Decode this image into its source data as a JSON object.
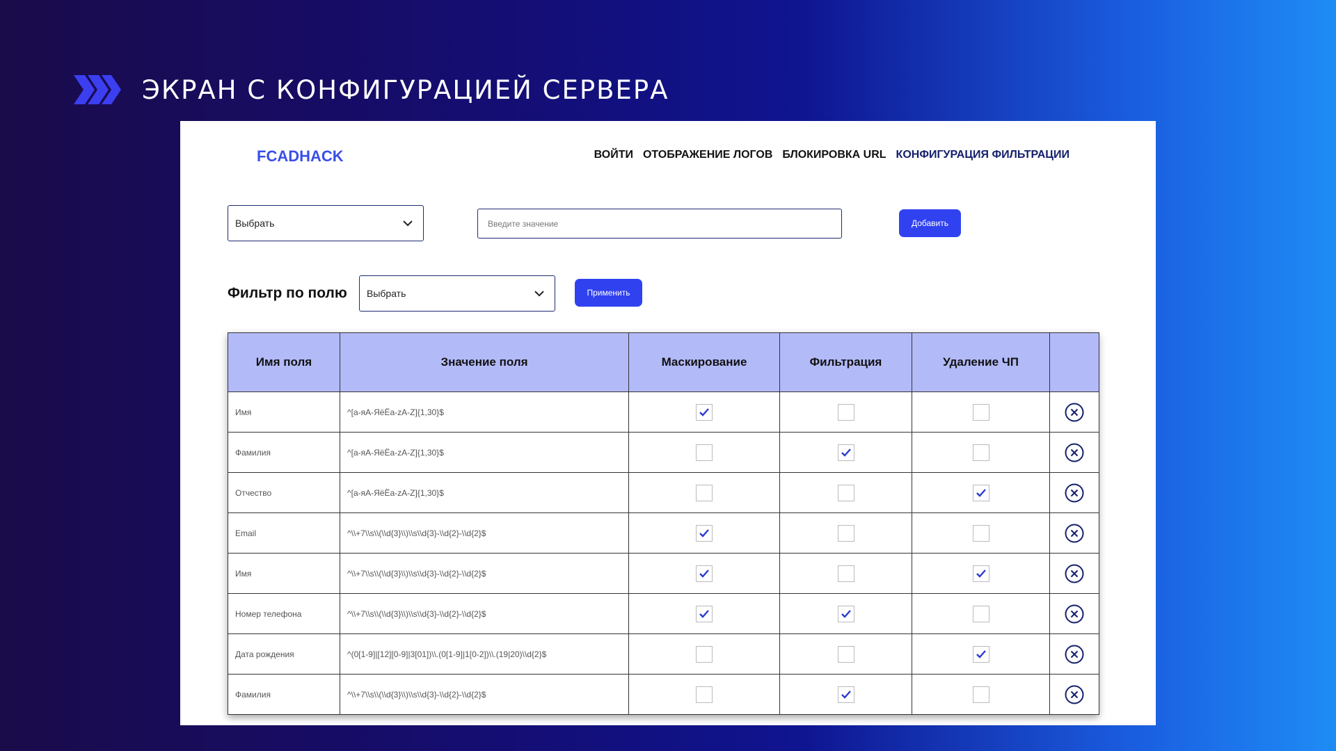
{
  "slide": {
    "title": "ЭКРАН С КОНФИГУРАЦИЕЙ СЕРВЕРА"
  },
  "app": {
    "logo": "FCADHACK",
    "nav": [
      {
        "label": "ВОЙТИ"
      },
      {
        "label": "ОТОБРАЖЕНИЕ ЛОГОВ"
      },
      {
        "label": "БЛОКИРОВКА URL"
      },
      {
        "label": "КОНФИГУРАЦИЯ ФИЛЬТРАЦИИ"
      }
    ],
    "add_row": {
      "select_value": "Выбрать",
      "input_placeholder": "Введите значение",
      "input_value": "",
      "add_button": "Добавить"
    },
    "filter_row": {
      "label": "Фильтр по полю",
      "select_value": "Выбрать",
      "apply_button": "Применить"
    },
    "table": {
      "headers": [
        "Имя поля",
        "Значение поля",
        "Маскирование",
        "Фильтрация",
        "Удаление ЧП",
        ""
      ],
      "rows": [
        {
          "name": "Имя",
          "value": "^[а-яА-ЯёЁa-zA-Z]{1,30}$",
          "masking": true,
          "filtering": false,
          "deletion": false
        },
        {
          "name": "Фамилия",
          "value": "^[а-яА-ЯёЁa-zA-Z]{1,30}$",
          "masking": false,
          "filtering": true,
          "deletion": false
        },
        {
          "name": "Отчество",
          "value": "^[а-яА-ЯёЁa-zA-Z]{1,30}$",
          "masking": false,
          "filtering": false,
          "deletion": true
        },
        {
          "name": "Email",
          "value": "^\\\\+7\\\\s\\\\(\\\\d{3}\\\\)\\\\s\\\\d{3}-\\\\d{2}-\\\\d{2}$",
          "masking": true,
          "filtering": false,
          "deletion": false
        },
        {
          "name": "Имя",
          "value": "^\\\\+7\\\\s\\\\(\\\\d{3}\\\\)\\\\s\\\\d{3}-\\\\d{2}-\\\\d{2}$",
          "masking": true,
          "filtering": false,
          "deletion": true
        },
        {
          "name": "Номер телефона",
          "value": "^\\\\+7\\\\s\\\\(\\\\d{3}\\\\)\\\\s\\\\d{3}-\\\\d{2}-\\\\d{2}$",
          "masking": true,
          "filtering": true,
          "deletion": false
        },
        {
          "name": "Дата рождения",
          "value": "^(0[1-9]|[12][0-9]|3[01])\\\\.(0[1-9]|1[0-2])\\\\.(19|20)\\\\d{2}$",
          "masking": false,
          "filtering": false,
          "deletion": true
        },
        {
          "name": "Фамилия",
          "value": "^\\\\+7\\\\s\\\\(\\\\d{3}\\\\)\\\\s\\\\d{3}-\\\\d{2}-\\\\d{2}$",
          "masking": false,
          "filtering": true,
          "deletion": false
        }
      ],
      "delete_icon": "close-circle-icon"
    }
  },
  "colors": {
    "accent": "#3042f0",
    "logo": "#3a4ee6",
    "table_header": "#b3baf8",
    "check": "#2a3ad0",
    "delete_icon": "#15206b"
  }
}
